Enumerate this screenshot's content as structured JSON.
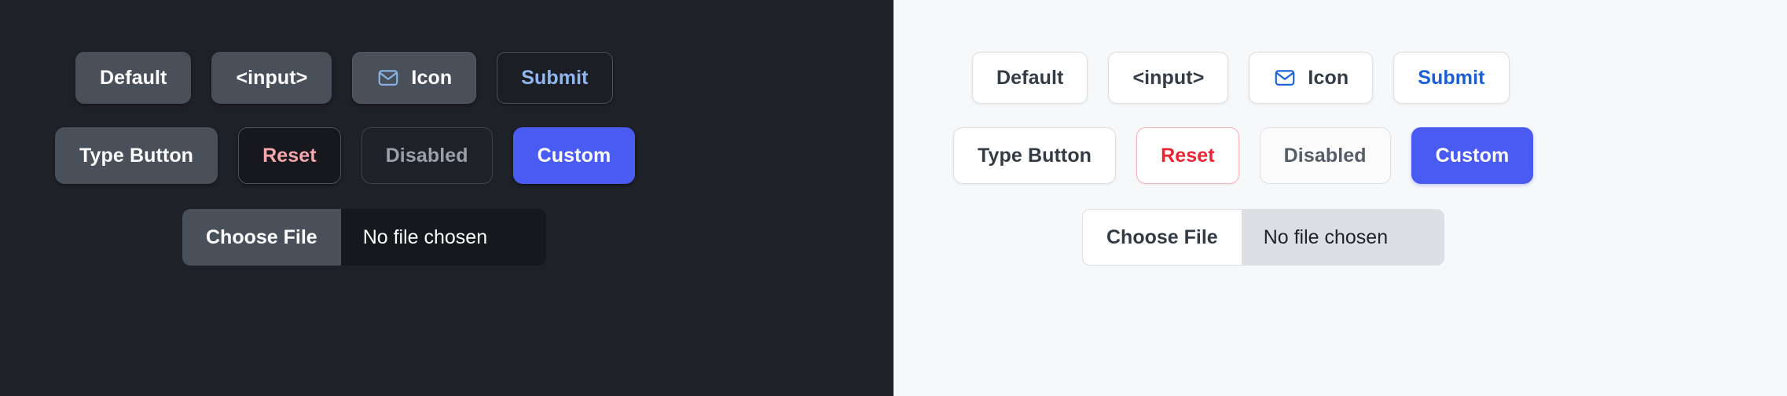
{
  "panels": {
    "dark": {
      "name": "dark-theme-panel",
      "background": "#1e2127",
      "row1": [
        {
          "label": "Default",
          "name": "default-button",
          "icon": null
        },
        {
          "label": "<input>",
          "name": "input-button",
          "icon": null
        },
        {
          "label": "Icon",
          "name": "icon-button",
          "icon": "envelope-icon",
          "icon_color": "#8ab4e8"
        },
        {
          "label": "Submit",
          "name": "submit-button",
          "icon": null,
          "text_color": "#92b6ef"
        }
      ],
      "row2": [
        {
          "label": "Type Button",
          "name": "type-button"
        },
        {
          "label": "Reset",
          "name": "reset-button",
          "text_color": "#f7a8ad"
        },
        {
          "label": "Disabled",
          "name": "disabled-button",
          "disabled": true
        },
        {
          "label": "Custom",
          "name": "custom-button",
          "background": "#4a5bf2"
        }
      ],
      "file_input": {
        "button_label": "Choose File",
        "status_text": "No file chosen",
        "track_color": "#16181d",
        "button_color": "#4a505a"
      }
    },
    "light": {
      "name": "light-theme-panel",
      "background": "#f7f8fa",
      "row1": [
        {
          "label": "Default",
          "name": "default-button",
          "icon": null
        },
        {
          "label": "<input>",
          "name": "input-button",
          "icon": null
        },
        {
          "label": "Icon",
          "name": "icon-button",
          "icon": "envelope-icon",
          "icon_color": "#1a5fd6"
        },
        {
          "label": "Submit",
          "name": "submit-button",
          "icon": null,
          "text_color": "#1a5fd6"
        }
      ],
      "row2": [
        {
          "label": "Type Button",
          "name": "type-button"
        },
        {
          "label": "Reset",
          "name": "reset-button",
          "text_color": "#ef2233",
          "border_color": "#f6b4b6"
        },
        {
          "label": "Disabled",
          "name": "disabled-button",
          "disabled": true
        },
        {
          "label": "Custom",
          "name": "custom-button",
          "background": "#4a5bf2"
        }
      ],
      "file_input": {
        "button_label": "Choose File",
        "status_text": "No file chosen",
        "track_color": "#dcdfe4",
        "button_color": "#ffffff"
      }
    }
  }
}
